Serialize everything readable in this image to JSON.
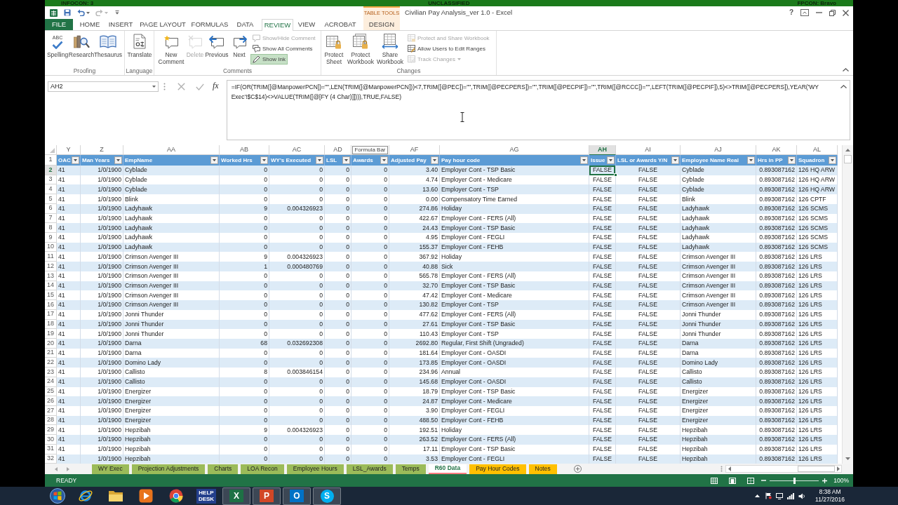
{
  "classification_bar": {
    "infocon": "INFOCON: 3",
    "classification": "UNCLASSIFIED",
    "fpcon": "FPCON: Bravo"
  },
  "title_bar": {
    "contextual_group": "TABLE TOOLS",
    "title": "Civilian Pay Analysis_ver 1.0 - Excel",
    "help": "?"
  },
  "ribbon_tabs": [
    {
      "label": "FILE",
      "kind": "file",
      "selected": false
    },
    {
      "label": "HOME",
      "kind": "normal",
      "selected": false
    },
    {
      "label": "INSERT",
      "kind": "normal",
      "selected": false
    },
    {
      "label": "PAGE LAYOUT",
      "kind": "normal",
      "selected": false
    },
    {
      "label": "FORMULAS",
      "kind": "normal",
      "selected": false
    },
    {
      "label": "DATA",
      "kind": "normal",
      "selected": false
    },
    {
      "label": "REVIEW",
      "kind": "normal",
      "selected": true
    },
    {
      "label": "VIEW",
      "kind": "normal",
      "selected": false
    },
    {
      "label": "ACROBAT",
      "kind": "normal",
      "selected": false
    },
    {
      "label": "DESIGN",
      "kind": "contextual",
      "selected": false
    }
  ],
  "ribbon_groups": [
    {
      "label": "Proofing",
      "buttons": [
        {
          "kind": "large",
          "label": "Spelling",
          "icon_text": "ABC",
          "disabled": false
        },
        {
          "kind": "large",
          "label": "Research",
          "disabled": false
        },
        {
          "kind": "large",
          "label": "Thesaurus",
          "disabled": false
        }
      ]
    },
    {
      "label": "Language",
      "buttons": [
        {
          "kind": "large",
          "label": "Translate",
          "disabled": false
        }
      ]
    },
    {
      "label": "Comments",
      "buttons": [
        {
          "kind": "large",
          "label": "New Comment",
          "disabled": false
        },
        {
          "kind": "large",
          "label": "Delete",
          "disabled": true
        },
        {
          "kind": "large",
          "label": "Previous",
          "disabled": false
        },
        {
          "kind": "large",
          "label": "Next",
          "disabled": false
        },
        {
          "kind": "small",
          "label": "Show/Hide Comment",
          "disabled": true,
          "on": false,
          "dropdown": false
        },
        {
          "kind": "small",
          "label": "Show All Comments",
          "disabled": false,
          "on": false,
          "dropdown": false
        },
        {
          "kind": "small",
          "label": "Show Ink",
          "disabled": false,
          "on": true,
          "dropdown": false
        }
      ]
    },
    {
      "label": "Changes",
      "buttons": [
        {
          "kind": "large",
          "label": "Protect Sheet",
          "disabled": false
        },
        {
          "kind": "large",
          "label": "Protect Workbook",
          "disabled": false
        },
        {
          "kind": "large",
          "label": "Share Workbook",
          "disabled": false
        },
        {
          "kind": "small",
          "label": "Protect and Share Workbook",
          "disabled": true,
          "on": false,
          "dropdown": false
        },
        {
          "kind": "small",
          "label": "Allow Users to Edit Ranges",
          "disabled": false,
          "on": false,
          "dropdown": false
        },
        {
          "kind": "small",
          "label": "Track Changes",
          "disabled": true,
          "on": false,
          "dropdown": true
        }
      ]
    }
  ],
  "formula_bar": {
    "name_box": "AH2",
    "function_button": "fx",
    "formula": "=IF(OR(TRIM([@ManpowerPCN])=\"\",LEN(TRIM([@ManpowerPCN]))<7,TRIM([@PEC])=\"\",TRIM([@PECPERS])=\"\",TRIM([@PECPIF])=\"\",TRIM([@RCCC])=\"\",LEFT(TRIM([@PECPIF]),5)<>TRIM([@PECPERS]),YEAR('WY Exec'!$C$14)<>VALUE(TRIM([@[FY (4 Char)]]))),TRUE,FALSE)"
  },
  "sheet": {
    "columns": [
      {
        "letter": "Y",
        "header": "OAC",
        "kind": "text",
        "selected": false
      },
      {
        "letter": "Z",
        "header": "Man Years",
        "kind": "number",
        "selected": false
      },
      {
        "letter": "AA",
        "header": "EmpName",
        "kind": "text",
        "selected": false
      },
      {
        "letter": "AB",
        "header": "Worked Hrs",
        "kind": "number",
        "selected": false
      },
      {
        "letter": "AC",
        "header": "WY's Executed",
        "kind": "number",
        "selected": false
      },
      {
        "letter": "AD",
        "header": "LSL",
        "kind": "number",
        "selected": false
      },
      {
        "tooltip": "Formula Bar",
        "header": "Awards",
        "kind": "number",
        "selected": false
      },
      {
        "letter": "AF",
        "header": "Adjusted Pay",
        "kind": "number",
        "selected": false
      },
      {
        "letter": "AG",
        "header": "Pay hour code",
        "kind": "text",
        "selected": false
      },
      {
        "letter": "AH",
        "header": "Issue",
        "kind": "boolean",
        "selected": true
      },
      {
        "letter": "AI",
        "header": "LSL or Awards Y/N",
        "kind": "boolean",
        "selected": false
      },
      {
        "letter": "AJ",
        "header": "Employee Name Real",
        "kind": "text",
        "selected": false
      },
      {
        "letter": "AK",
        "header": "Hrs in PP",
        "kind": "number",
        "selected": false
      },
      {
        "letter": "AL",
        "header": "Squadron",
        "kind": "text",
        "selected": false
      }
    ],
    "header_row": "1",
    "rows": [
      {
        "number": "2",
        "selected": true,
        "cells": [
          "41",
          "1/0/1900",
          "Cyblade",
          "0",
          "0",
          "0",
          "0",
          "3.40",
          "Employer Cont - TSP Basic",
          "FALSE",
          "FALSE",
          "Cyblade",
          "0.893087162",
          "126 HQ ARW"
        ]
      },
      {
        "number": "3",
        "selected": false,
        "cells": [
          "41",
          "1/0/1900",
          "Cyblade",
          "0",
          "0",
          "0",
          "0",
          "4.74",
          "Employer Cont - Medicare",
          "FALSE",
          "FALSE",
          "Cyblade",
          "0.893087162",
          "126 HQ ARW"
        ]
      },
      {
        "number": "4",
        "selected": false,
        "cells": [
          "41",
          "1/0/1900",
          "Cyblade",
          "0",
          "0",
          "0",
          "0",
          "13.60",
          "Employer Cont - TSP",
          "FALSE",
          "FALSE",
          "Cyblade",
          "0.893087162",
          "126 HQ ARW"
        ]
      },
      {
        "number": "5",
        "selected": false,
        "cells": [
          "41",
          "1/0/1900",
          "Blink",
          "0",
          "0",
          "0",
          "0",
          "0.00",
          "Compensatory Time Earned",
          "FALSE",
          "FALSE",
          "Blink",
          "0.893087162",
          "126 CPTF"
        ]
      },
      {
        "number": "6",
        "selected": false,
        "cells": [
          "41",
          "1/0/1900",
          "Ladyhawk",
          "9",
          "0.004326923",
          "0",
          "0",
          "274.86",
          "Holiday",
          "FALSE",
          "FALSE",
          "Ladyhawk",
          "0.893087162",
          "126 SCMS"
        ]
      },
      {
        "number": "7",
        "selected": false,
        "cells": [
          "41",
          "1/0/1900",
          "Ladyhawk",
          "0",
          "0",
          "0",
          "0",
          "422.67",
          "Employer Cont - FERS (All)",
          "FALSE",
          "FALSE",
          "Ladyhawk",
          "0.893087162",
          "126 SCMS"
        ]
      },
      {
        "number": "8",
        "selected": false,
        "cells": [
          "41",
          "1/0/1900",
          "Ladyhawk",
          "0",
          "0",
          "0",
          "0",
          "24.43",
          "Employer Cont - TSP Basic",
          "FALSE",
          "FALSE",
          "Ladyhawk",
          "0.893087162",
          "126 SCMS"
        ]
      },
      {
        "number": "9",
        "selected": false,
        "cells": [
          "41",
          "1/0/1900",
          "Ladyhawk",
          "0",
          "0",
          "0",
          "0",
          "4.95",
          "Employer Cont - FEGLI",
          "FALSE",
          "FALSE",
          "Ladyhawk",
          "0.893087162",
          "126 SCMS"
        ]
      },
      {
        "number": "10",
        "selected": false,
        "cells": [
          "41",
          "1/0/1900",
          "Ladyhawk",
          "0",
          "0",
          "0",
          "0",
          "155.37",
          "Employer Cont - FEHB",
          "FALSE",
          "FALSE",
          "Ladyhawk",
          "0.893087162",
          "126 SCMS"
        ]
      },
      {
        "number": "11",
        "selected": false,
        "cells": [
          "41",
          "1/0/1900",
          "Crimson Avenger III",
          "9",
          "0.004326923",
          "0",
          "0",
          "367.92",
          "Holiday",
          "FALSE",
          "FALSE",
          "Crimson Avenger III",
          "0.893087162",
          "126 LRS"
        ]
      },
      {
        "number": "12",
        "selected": false,
        "cells": [
          "41",
          "1/0/1900",
          "Crimson Avenger III",
          "1",
          "0.000480769",
          "0",
          "0",
          "40.88",
          "Sick",
          "FALSE",
          "FALSE",
          "Crimson Avenger III",
          "0.893087162",
          "126 LRS"
        ]
      },
      {
        "number": "13",
        "selected": false,
        "cells": [
          "41",
          "1/0/1900",
          "Crimson Avenger III",
          "0",
          "0",
          "0",
          "0",
          "565.78",
          "Employer Cont - FERS (All)",
          "FALSE",
          "FALSE",
          "Crimson Avenger III",
          "0.893087162",
          "126 LRS"
        ]
      },
      {
        "number": "14",
        "selected": false,
        "cells": [
          "41",
          "1/0/1900",
          "Crimson Avenger III",
          "0",
          "0",
          "0",
          "0",
          "32.70",
          "Employer Cont - TSP Basic",
          "FALSE",
          "FALSE",
          "Crimson Avenger III",
          "0.893087162",
          "126 LRS"
        ]
      },
      {
        "number": "15",
        "selected": false,
        "cells": [
          "41",
          "1/0/1900",
          "Crimson Avenger III",
          "0",
          "0",
          "0",
          "0",
          "47.42",
          "Employer Cont - Medicare",
          "FALSE",
          "FALSE",
          "Crimson Avenger III",
          "0.893087162",
          "126 LRS"
        ]
      },
      {
        "number": "16",
        "selected": false,
        "cells": [
          "41",
          "1/0/1900",
          "Crimson Avenger III",
          "0",
          "0",
          "0",
          "0",
          "130.82",
          "Employer Cont - TSP",
          "FALSE",
          "FALSE",
          "Crimson Avenger III",
          "0.893087162",
          "126 LRS"
        ]
      },
      {
        "number": "17",
        "selected": false,
        "cells": [
          "41",
          "1/0/1900",
          "Jonni Thunder",
          "0",
          "0",
          "0",
          "0",
          "477.62",
          "Employer Cont - FERS (All)",
          "FALSE",
          "FALSE",
          "Jonni Thunder",
          "0.893087162",
          "126 LRS"
        ]
      },
      {
        "number": "18",
        "selected": false,
        "cells": [
          "41",
          "1/0/1900",
          "Jonni Thunder",
          "0",
          "0",
          "0",
          "0",
          "27.61",
          "Employer Cont - TSP Basic",
          "FALSE",
          "FALSE",
          "Jonni Thunder",
          "0.893087162",
          "126 LRS"
        ]
      },
      {
        "number": "19",
        "selected": false,
        "cells": [
          "41",
          "1/0/1900",
          "Jonni Thunder",
          "0",
          "0",
          "0",
          "0",
          "110.43",
          "Employer Cont - TSP",
          "FALSE",
          "FALSE",
          "Jonni Thunder",
          "0.893087162",
          "126 LRS"
        ]
      },
      {
        "number": "20",
        "selected": false,
        "cells": [
          "41",
          "1/0/1900",
          "Darna",
          "68",
          "0.032692308",
          "0",
          "0",
          "2692.80",
          "Regular, First Shift (Ungraded)",
          "FALSE",
          "FALSE",
          "Darna",
          "0.893087162",
          "126 LRS"
        ]
      },
      {
        "number": "21",
        "selected": false,
        "cells": [
          "41",
          "1/0/1900",
          "Darna",
          "0",
          "0",
          "0",
          "0",
          "181.64",
          "Employer Cont - OASDI",
          "FALSE",
          "FALSE",
          "Darna",
          "0.893087162",
          "126 LRS"
        ]
      },
      {
        "number": "22",
        "selected": false,
        "cells": [
          "41",
          "1/0/1900",
          "Domino Lady",
          "0",
          "0",
          "0",
          "0",
          "173.85",
          "Employer Cont - OASDI",
          "FALSE",
          "FALSE",
          "Domino Lady",
          "0.893087162",
          "126 LRS"
        ]
      },
      {
        "number": "23",
        "selected": false,
        "cells": [
          "41",
          "1/0/1900",
          "Callisto",
          "8",
          "0.003846154",
          "0",
          "0",
          "234.96",
          "Annual",
          "FALSE",
          "FALSE",
          "Callisto",
          "0.893087162",
          "126 LRS"
        ]
      },
      {
        "number": "24",
        "selected": false,
        "cells": [
          "41",
          "1/0/1900",
          "Callisto",
          "0",
          "0",
          "0",
          "0",
          "145.68",
          "Employer Cont - OASDI",
          "FALSE",
          "FALSE",
          "Callisto",
          "0.893087162",
          "126 LRS"
        ]
      },
      {
        "number": "25",
        "selected": false,
        "cells": [
          "41",
          "1/0/1900",
          "Energizer",
          "0",
          "0",
          "0",
          "0",
          "18.79",
          "Employer Cont - TSP Basic",
          "FALSE",
          "FALSE",
          "Energizer",
          "0.893087162",
          "126 LRS"
        ]
      },
      {
        "number": "26",
        "selected": false,
        "cells": [
          "41",
          "1/0/1900",
          "Energizer",
          "0",
          "0",
          "0",
          "0",
          "24.87",
          "Employer Cont - Medicare",
          "FALSE",
          "FALSE",
          "Energizer",
          "0.893087162",
          "126 LRS"
        ]
      },
      {
        "number": "27",
        "selected": false,
        "cells": [
          "41",
          "1/0/1900",
          "Energizer",
          "0",
          "0",
          "0",
          "0",
          "3.90",
          "Employer Cont - FEGLI",
          "FALSE",
          "FALSE",
          "Energizer",
          "0.893087162",
          "126 LRS"
        ]
      },
      {
        "number": "28",
        "selected": false,
        "cells": [
          "41",
          "1/0/1900",
          "Energizer",
          "0",
          "0",
          "0",
          "0",
          "488.50",
          "Employer Cont - FEHB",
          "FALSE",
          "FALSE",
          "Energizer",
          "0.893087162",
          "126 LRS"
        ]
      },
      {
        "number": "29",
        "selected": false,
        "cells": [
          "41",
          "1/0/1900",
          "Hepzibah",
          "9",
          "0.004326923",
          "0",
          "0",
          "192.51",
          "Holiday",
          "FALSE",
          "FALSE",
          "Hepzibah",
          "0.893087162",
          "126 LRS"
        ]
      },
      {
        "number": "30",
        "selected": false,
        "cells": [
          "41",
          "1/0/1900",
          "Hepzibah",
          "0",
          "0",
          "0",
          "0",
          "263.52",
          "Employer Cont - FERS (All)",
          "FALSE",
          "FALSE",
          "Hepzibah",
          "0.893087162",
          "126 LRS"
        ]
      },
      {
        "number": "31",
        "selected": false,
        "cells": [
          "41",
          "1/0/1900",
          "Hepzibah",
          "0",
          "0",
          "0",
          "0",
          "17.11",
          "Employer Cont - TSP Basic",
          "FALSE",
          "FALSE",
          "Hepzibah",
          "0.893087162",
          "126 LRS"
        ]
      },
      {
        "number": "32",
        "selected": false,
        "cells": [
          "41",
          "1/0/1900",
          "Hepzibah",
          "0",
          "0",
          "0",
          "0",
          "3.53",
          "Employer Cont - FEGLI",
          "FALSE",
          "FALSE",
          "Hepzibah",
          "0.893087162",
          "126 LRS"
        ]
      }
    ]
  },
  "sheet_tabs": [
    {
      "label": "WY Exec",
      "color": "#9bbb59",
      "selected": false
    },
    {
      "label": "Projection Adjustments",
      "color": "#9bbb59",
      "selected": false
    },
    {
      "label": "Charts",
      "color": "#9bbb59",
      "selected": false
    },
    {
      "label": "LOA Recon",
      "color": "#9bbb59",
      "selected": false
    },
    {
      "label": "Employee Hours",
      "color": "#9bbb59",
      "selected": false
    },
    {
      "label": "LSL_Awards",
      "color": "#9bbb59",
      "selected": false
    },
    {
      "label": "Temps",
      "color": "#9bbb59",
      "selected": false
    },
    {
      "label": "R60 Data",
      "color": "#ff7c80",
      "selected": true
    },
    {
      "label": "Pay Hour Codes",
      "color": "#ffc000",
      "selected": false
    },
    {
      "label": "Notes",
      "color": "#ffc000",
      "selected": false
    }
  ],
  "status_bar": {
    "mode": "READY",
    "zoom": {
      "label": "100%",
      "level": 0.5
    }
  },
  "taskbar": {
    "apps": [
      {
        "running": false
      },
      {
        "running": false
      },
      {
        "running": false
      },
      {
        "running": false
      },
      {
        "label": "HELP DESK",
        "running": false
      },
      {
        "label": "X",
        "running": true
      },
      {
        "label": "P",
        "running": true
      },
      {
        "label": "O",
        "running": true
      },
      {
        "label": "S",
        "running": true
      }
    ],
    "clock": {
      "time": "8:38 AM",
      "date": "11/27/2016"
    }
  }
}
